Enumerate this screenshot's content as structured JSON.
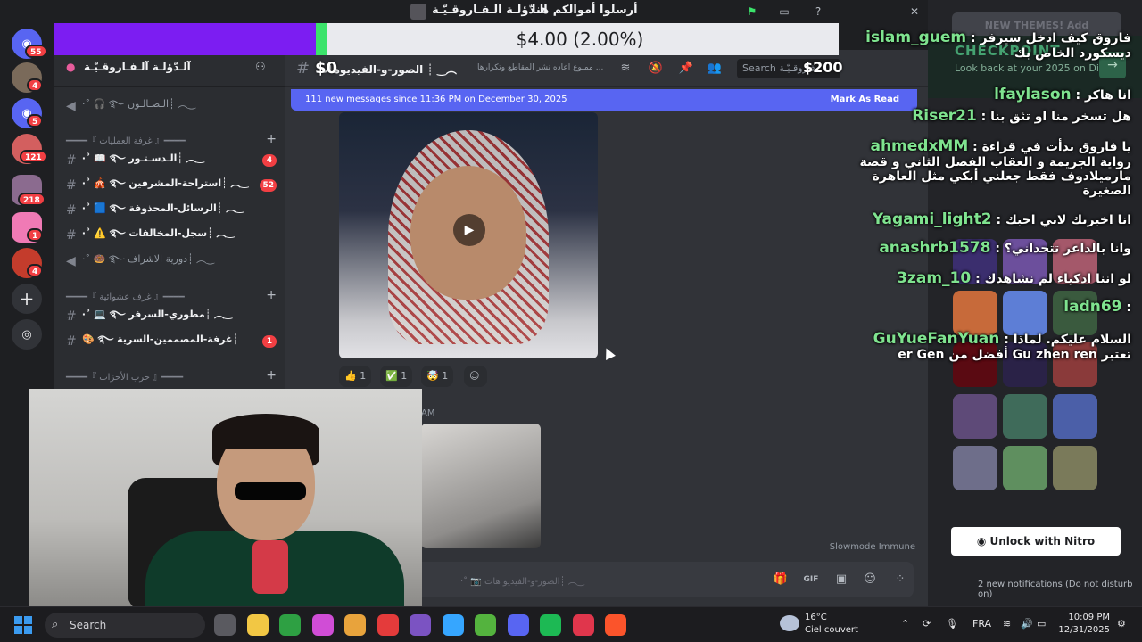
{
  "window": {
    "title": "أرسلوا أموالكم هنا",
    "server_title": "الـدّؤلـة الـفـاروقـيّـة"
  },
  "donation": {
    "amount_text": "$4.00 (2.00%)",
    "progress_fraction": 0.02,
    "fill_color": "#7c1df2",
    "edge_color": "#3be36b",
    "ticker_left": "$0",
    "ticker_right": "$200"
  },
  "rail": {
    "badges": [
      "55",
      "4",
      "5",
      "121",
      "218",
      "1",
      "4"
    ],
    "icons": [
      "discord-home-icon",
      "avatar-icon",
      "discord-icon",
      "server-icon",
      "server-icon",
      "server-icon",
      "server-icon",
      "add-server-icon",
      "explore-icon"
    ]
  },
  "sidebar": {
    "server_name": "آلـدّؤلـة آلـفـاروقـيّـة",
    "channels": [
      {
        "type": "voice",
        "label": "‿︵ ┊الـصـالـون ࿐ 🎧 ˚‧",
        "badge": ""
      },
      {
        "type": "category",
        "label": "━━━━『 غرفة العمليات 』━━━━",
        "badge": ""
      },
      {
        "type": "text",
        "label": "‿︵ ┊الـدسـتـور ࿐ 📖 ˚‧",
        "badge": "4"
      },
      {
        "type": "text",
        "label": "‿︵ ┊استراحة-المشرفين ࿐ 🎪 ˚‧",
        "badge": "52"
      },
      {
        "type": "text",
        "label": "‿︵ ┊الرسائل-المحذوفة ࿐ 🟦 ˚‧",
        "badge": ""
      },
      {
        "type": "text",
        "label": "‿︵ ┊سجل-المخالفات ࿐ ⚠️ ˚‧",
        "badge": ""
      },
      {
        "type": "voice",
        "label": "‿︵ ┊دورية الاشراف ࿐ 🍩 ˚‧",
        "badge": ""
      },
      {
        "type": "category",
        "label": "━━━━『 غرف عشوائية 』━━━━",
        "badge": ""
      },
      {
        "type": "text",
        "label": "‿︵ ┊مطوري-السرفر ࿐ 💻 ˚‧",
        "badge": ""
      },
      {
        "type": "text",
        "label": "┊غرفة-المصممين-السرية ࿐ 🎨",
        "badge": "1"
      },
      {
        "type": "category",
        "label": "━━━━『 حرب الأحزاب 』━━━━",
        "badge": ""
      }
    ]
  },
  "channel": {
    "name": "الصور-و-الفيديوهات ┊ ‿︵",
    "topic": "ممنوع اعاده نشر المقاطع وتكرارها ...",
    "search_placeholder": "Search فاروقـيّـة",
    "new_messages": "111 new messages since 11:36 PM on December 30, 2025",
    "mark_as_read": "Mark As Read",
    "reactions": [
      {
        "emoji": "👍",
        "count": "1"
      },
      {
        "emoji": "✅",
        "count": "1"
      },
      {
        "emoji": "🤯",
        "count": "1"
      }
    ],
    "timestamp2": "AM",
    "slowmode": "Slowmode Immune",
    "composer_placeholder": "‿︵ ┊الصور-و-الفيديو هات 📷 ˚‧"
  },
  "themes_panel": {
    "new_themes": "NEW THEMES! Add",
    "checkpoint_title": "CHECKPOINT",
    "checkpoint_sub": "Look back at your 2025 on Discord",
    "unlock_nitro": "Unlock with Nitro",
    "notifications": "2 new notifications (Do not disturb on)",
    "swatch_colors": [
      "#3b2e6e",
      "#6c4f9c",
      "#a4586a",
      "#c76a3a",
      "#5d7ed6",
      "#3a5a3e",
      "#5a0a12",
      "#2a2247",
      "#8a3a3a",
      "#5e4a78",
      "#3f6b5a",
      "#4b5fa8",
      "#6e6e8a",
      "#5f8f5f",
      "#7a7a5a"
    ]
  },
  "stream_chat": [
    {
      "user": "islam_guem",
      "text": "فاروق كيف ادخل سيرفر ديسكورد الخاص بك"
    },
    {
      "user": "lfaylason",
      "text": "انا هاكر"
    },
    {
      "user": "Riser21",
      "text": "هل تسخر منا او تثق بنا"
    },
    {
      "user": "ahmedxMM",
      "text": "يا فاروق بدأت في قراءة رواية الجريمة و العقاب الفصل الثاني و قصة مارميلادوف فقط جعلني أبكي مثل العاهرة الصغيرة"
    },
    {
      "user": "Yagami_light2",
      "text": "انا اخبرتك لاني احبك"
    },
    {
      "user": "anashrb1578",
      "text": "وانا بالداعر تتحداني؟"
    },
    {
      "user": "3zam_10",
      "text": "لو اننا اذكياء لم نشاهدك"
    },
    {
      "user": "ladn69",
      "text": ""
    },
    {
      "user": "GuYueFanYuan",
      "text": "السلام عليكم. لماذا تعتبر Gu zhen ren أفضل من er Gen"
    }
  ],
  "taskbar": {
    "search_label": "Search",
    "weather_temp": "16°C",
    "weather_cond": "Ciel couvert",
    "language": "FRA",
    "time": "10:09 PM",
    "date": "12/31/2025",
    "app_colors": [
      "#5a5a60",
      "#f2c744",
      "#2ea043",
      "#d04dd6",
      "#e8a33c",
      "#e43b3b",
      "#7b53c2",
      "#36a6ff",
      "#54b33e",
      "#5865f2",
      "#1db954",
      "#e0364c",
      "#fb542b"
    ]
  }
}
